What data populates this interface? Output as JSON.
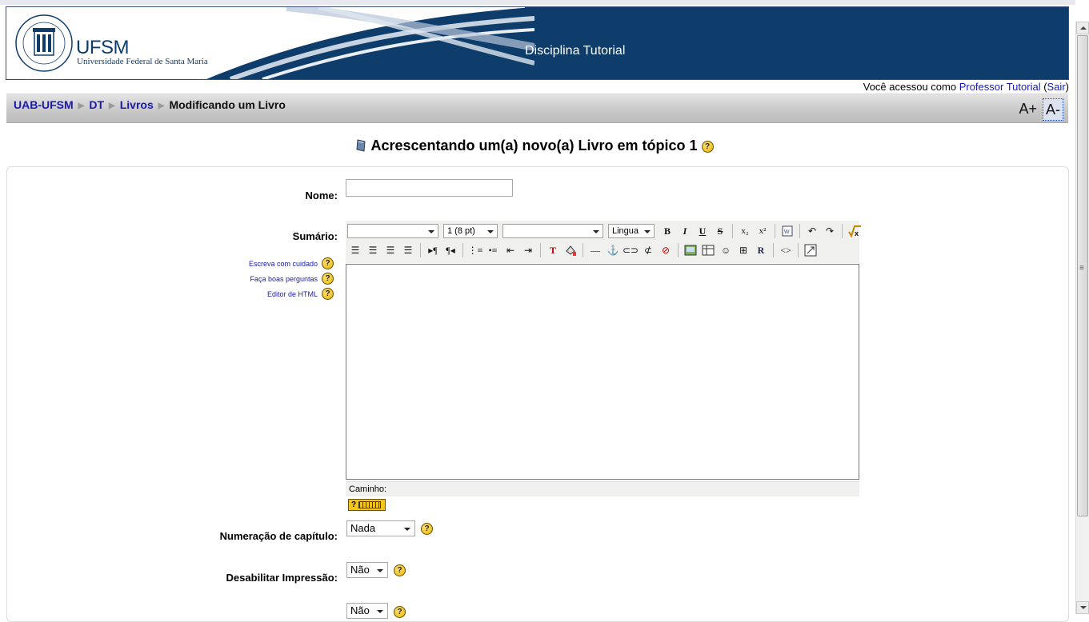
{
  "header": {
    "university_short": "UFSM",
    "university_full": "Universidade Federal de Santa Maria",
    "course_title": "Disciplina Tutorial"
  },
  "login": {
    "prefix": "Você acessou como ",
    "user": "Professor Tutorial",
    "open_paren": " (",
    "logout": "Sair",
    "close_paren": ")"
  },
  "breadcrumb": {
    "items": [
      "UAB-UFSM",
      "DT",
      "Livros"
    ],
    "current": "Modificando um Livro",
    "separator": "▶"
  },
  "font_controls": {
    "increase": "A+",
    "decrease": "A-"
  },
  "page": {
    "heading": "Acrescentando um(a) novo(a) Livro em tópico 1"
  },
  "form": {
    "nome_label": "Nome:",
    "nome_value": "",
    "sumario_label": "Sumário:",
    "help_links": [
      "Escreva com cuidado",
      "Faça boas perguntas",
      "Editor de HTML"
    ],
    "editor": {
      "font_family_value": "",
      "font_size_value": "1 (8 pt)",
      "format_value": "",
      "language_value": "Lingua",
      "path_label": "Caminho:"
    },
    "numeracao_label": "Numeração de capítulo:",
    "numeracao_value": "Nada",
    "desabilitar_label": "Desabilitar Impressão:",
    "desabilitar_value": "Não",
    "third_select_value": "Não"
  },
  "colors": {
    "banner_blue": "#0e3d6b",
    "link_blue": "#1a1ab0",
    "help_yellow": "#e8b400"
  }
}
